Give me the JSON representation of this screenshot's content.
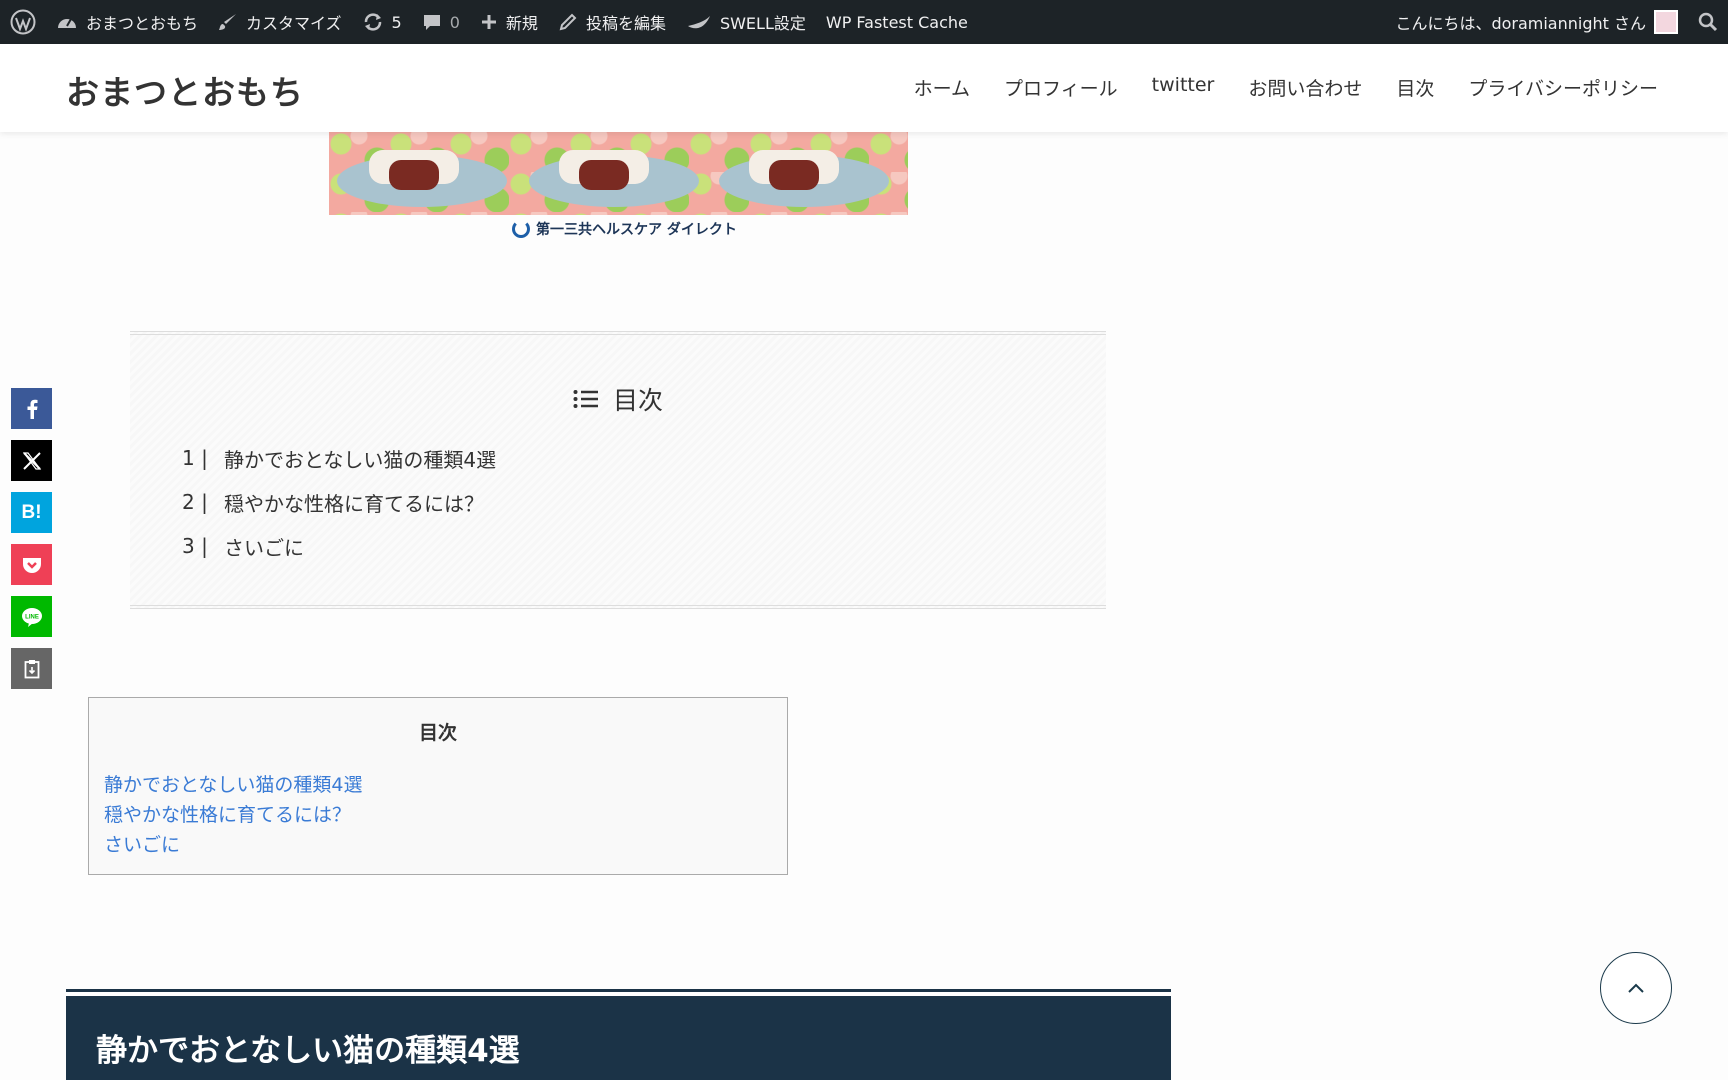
{
  "adminbar": {
    "site_name": "おまつとおもち",
    "customize": "カスタマイズ",
    "updates_count": "5",
    "comments_count": "0",
    "new_label": "新規",
    "edit_post": "投稿を編集",
    "swell_settings": "SWELL設定",
    "wp_fastest_cache": "WP Fastest Cache",
    "greeting": "こんにちは、doramiannight さん"
  },
  "header": {
    "site_title": "おまつとおもち",
    "nav": [
      "ホーム",
      "プロフィール",
      "twitter",
      "お問い合わせ",
      "目次",
      "プライバシーポリシー"
    ]
  },
  "ad": {
    "sponsor": "第一三共ヘルスケア ダイレクト"
  },
  "toc": {
    "title": "目次",
    "items": [
      {
        "num": "1",
        "sep": "|",
        "label": "静かでおとなしい猫の種類4選"
      },
      {
        "num": "2",
        "sep": "|",
        "label": "穏やかな性格に育てるには？"
      },
      {
        "num": "3",
        "sep": "|",
        "label": "さいごに"
      }
    ]
  },
  "share": {
    "hatena_label": "B!",
    "line_label": "LINE"
  },
  "toc2": {
    "title": "目次",
    "items": [
      "静かでおとなしい猫の種類4選",
      "穏やかな性格に育てるには？",
      "さいごに"
    ]
  },
  "section": {
    "h2": "静かでおとなしい猫の種類4選"
  },
  "colors": {
    "adminbar_bg": "#1d2327",
    "h2_bg": "#1b3347",
    "link": "#3a7bd5"
  }
}
